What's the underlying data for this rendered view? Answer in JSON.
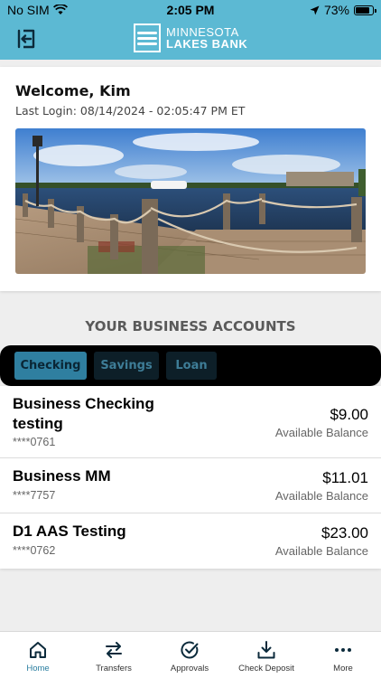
{
  "status_bar": {
    "carrier": "No SIM",
    "time": "2:05 PM",
    "battery": "73%"
  },
  "header": {
    "logo_line1": "MINNESOTA",
    "logo_line2": "LAKES BANK"
  },
  "welcome": {
    "title": "Welcome, Kim",
    "last_login": "Last Login: 08/14/2024 - 02:05:47 PM ET"
  },
  "section_title": "YOUR BUSINESS ACCOUNTS",
  "tabs": [
    {
      "label": "Checking",
      "active": true
    },
    {
      "label": "Savings",
      "active": false
    },
    {
      "label": "Loan",
      "active": false
    }
  ],
  "accounts": [
    {
      "name": "Business Checking testing",
      "number": "****0761",
      "balance": "$9.00",
      "balance_label": "Available Balance"
    },
    {
      "name": "Business MM",
      "number": "****7757",
      "balance": "$11.01",
      "balance_label": "Available Balance"
    },
    {
      "name": "D1 AAS Testing",
      "number": "****0762",
      "balance": "$23.00",
      "balance_label": "Available Balance"
    }
  ],
  "bottom_nav": [
    {
      "label": "Home",
      "icon": "home-icon",
      "active": true
    },
    {
      "label": "Transfers",
      "icon": "transfer-arrows-icon",
      "active": false
    },
    {
      "label": "Approvals",
      "icon": "check-circle-icon",
      "active": false
    },
    {
      "label": "Check Deposit",
      "icon": "download-tray-icon",
      "active": false
    },
    {
      "label": "More",
      "icon": "more-dots-icon",
      "active": false
    }
  ],
  "colors": {
    "header": "#5cb9d3",
    "accent": "#2a7ea0",
    "tab_active": "#2f7fa0",
    "tab_bar": "#000000"
  }
}
